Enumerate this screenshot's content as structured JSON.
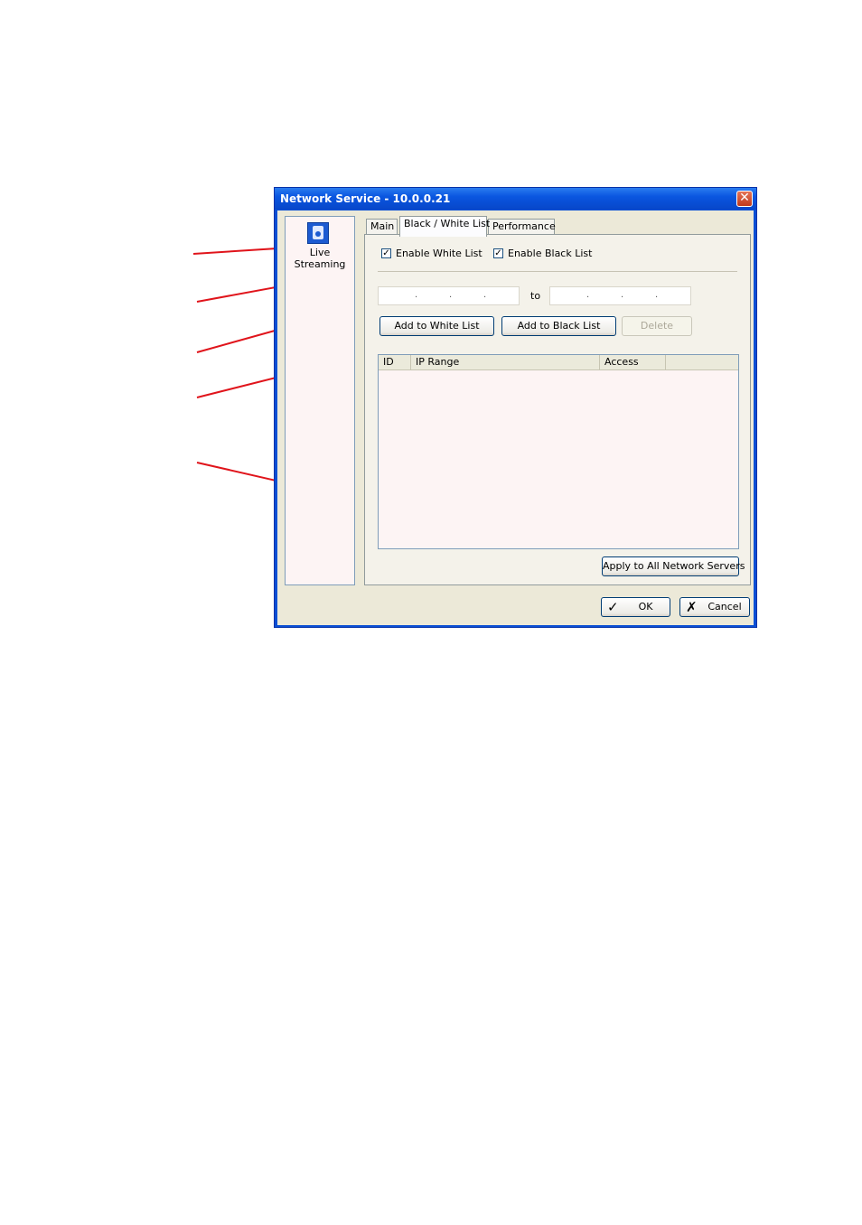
{
  "window": {
    "title": "Network Service - 10.0.0.21",
    "close_glyph": "✕"
  },
  "sidebar": {
    "items": [
      {
        "label": "Live\nStreaming",
        "icon": "live-streaming-icon"
      }
    ]
  },
  "tabs": [
    {
      "label": "Main",
      "active": false
    },
    {
      "label": "Black / White List",
      "active": true
    },
    {
      "label": "Performance",
      "active": false
    }
  ],
  "options": {
    "enable_white_list": {
      "label": "Enable White List",
      "checked": true
    },
    "enable_black_list": {
      "label": "Enable Black List",
      "checked": true
    },
    "check_glyph": "✓"
  },
  "ip_range": {
    "from_dots": [
      ".",
      ".",
      "."
    ],
    "to_label": "to",
    "to_dots": [
      ".",
      ".",
      "."
    ]
  },
  "buttons": {
    "add_white": "Add to White List",
    "add_black": "Add to Black List",
    "delete": "Delete",
    "apply_all": "Apply to All Network Servers",
    "ok": "OK",
    "cancel": "Cancel",
    "ok_glyph": "✓",
    "cancel_glyph": "✗"
  },
  "list": {
    "columns": [
      "ID",
      "IP Range",
      "Access",
      ""
    ],
    "rows": []
  },
  "colors": {
    "callout_line": "#e0141b",
    "titlebar": "#0a56e0",
    "panel": "#ece9d8"
  }
}
